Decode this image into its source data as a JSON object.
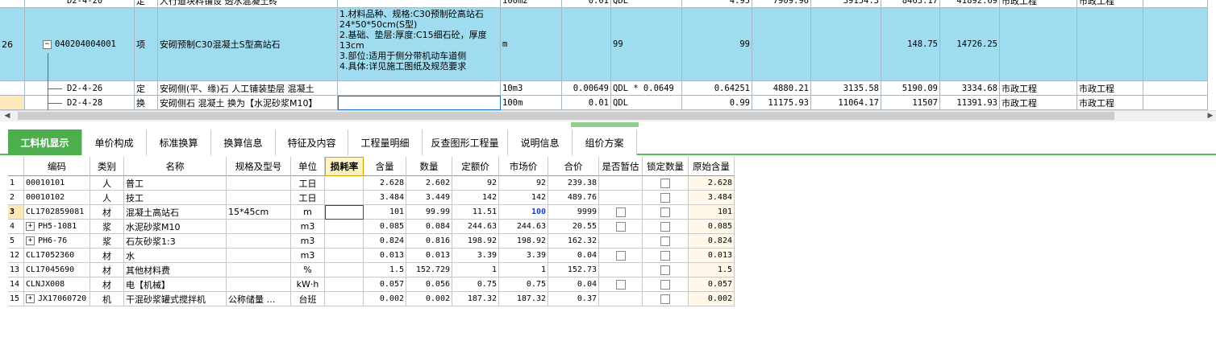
{
  "top_rows": [
    {
      "num": "",
      "code": "D2-4-20",
      "type": "定",
      "name": "人行道块料铺设 透水混凝土砖",
      "feature": "",
      "unit": "100m2",
      "qty": "0.01",
      "formula": "QDL",
      "amount": "4.95",
      "v1": "7909.96",
      "v2": "39154.3",
      "v3": "8463.17",
      "v4": "41892.69",
      "major": "市政工程",
      "major2": "市政工程"
    },
    {
      "num": "26",
      "code": "040204004001",
      "type": "项",
      "name": "安砌预制C30混凝土S型高站石",
      "feature": "1.材料品种、规格:C30预制砼高站石24*50*50cm(S型)\n2.基础、垫层:厚度:C15细石砼，厚度13cm\n3.部位:适用于侧分带机动车道侧\n4.具体:详见施工图纸及规范要求",
      "unit": "m",
      "qty": "",
      "formula": "99",
      "amount": "99",
      "v1": "",
      "v2": "",
      "v3": "148.75",
      "v4": "14726.25",
      "major": "",
      "major2": ""
    },
    {
      "num": "",
      "code": "D2-4-26",
      "type": "定",
      "name": "安砌侧(平、缘)石 人工铺装垫层 混凝土",
      "feature": "",
      "unit": "10m3",
      "qty": "0.00649",
      "formula": "QDL * 0.0649",
      "amount": "0.64251",
      "v1": "4880.21",
      "v2": "3135.58",
      "v3": "5190.09",
      "v4": "3334.68",
      "major": "市政工程",
      "major2": "市政工程"
    },
    {
      "num": "",
      "code": "D2-4-28",
      "type": "换",
      "name": "安砌侧石 混凝土  换为【水泥砂浆M10】",
      "feature": "",
      "unit": "100m",
      "qty": "0.01",
      "formula": "QDL",
      "amount": "0.99",
      "v1": "11175.93",
      "v2": "11064.17",
      "v3": "11507",
      "v4": "11391.93",
      "major": "市政工程",
      "major2": "市政工程"
    }
  ],
  "tabs": [
    "工料机显示",
    "单价构成",
    "标准换算",
    "换算信息",
    "特征及内容",
    "工程量明细",
    "反查图形工程量",
    "说明信息",
    "组价方案"
  ],
  "headers": [
    "编码",
    "类别",
    "名称",
    "规格及型号",
    "单位",
    "损耗率",
    "含量",
    "数量",
    "定额价",
    "市场价",
    "合价",
    "是否暂估",
    "锁定数量",
    "原始含量"
  ],
  "rows": [
    {
      "idx": "1",
      "code": "00010101",
      "cat": "人",
      "name": "普工",
      "spec": "",
      "unit": "工日",
      "loss": "",
      "content": "2.628",
      "qty": "2.602",
      "price": "92",
      "market": "92",
      "total": "239.38",
      "est": false,
      "lock": true,
      "orig": "2.628",
      "expand": false
    },
    {
      "idx": "2",
      "code": "00010102",
      "cat": "人",
      "name": "技工",
      "spec": "",
      "unit": "工日",
      "loss": "",
      "content": "3.484",
      "qty": "3.449",
      "price": "142",
      "market": "142",
      "total": "489.76",
      "est": false,
      "lock": true,
      "orig": "3.484",
      "expand": false
    },
    {
      "idx": "3",
      "code": "CL1702859081",
      "cat": "材",
      "name": "混凝土高站石",
      "spec": "15*45cm",
      "unit": "m",
      "loss": "",
      "content": "101",
      "qty": "99.99",
      "price": "11.51",
      "market": "100",
      "total": "9999",
      "est": true,
      "lock": true,
      "orig": "101",
      "expand": false
    },
    {
      "idx": "4",
      "code": "PH5-1081",
      "cat": "浆",
      "name": "水泥砂浆M10",
      "spec": "",
      "unit": "m3",
      "loss": "",
      "content": "0.085",
      "qty": "0.084",
      "price": "244.63",
      "market": "244.63",
      "total": "20.55",
      "est": true,
      "lock": true,
      "orig": "0.085",
      "expand": true
    },
    {
      "idx": "5",
      "code": "PH6-76",
      "cat": "浆",
      "name": "石灰砂浆1:3",
      "spec": "",
      "unit": "m3",
      "loss": "",
      "content": "0.824",
      "qty": "0.816",
      "price": "198.92",
      "market": "198.92",
      "total": "162.32",
      "est": false,
      "lock": true,
      "orig": "0.824",
      "expand": true
    },
    {
      "idx": "12",
      "code": "CL17052360",
      "cat": "材",
      "name": "水",
      "spec": "",
      "unit": "m3",
      "loss": "",
      "content": "0.013",
      "qty": "0.013",
      "price": "3.39",
      "market": "3.39",
      "total": "0.04",
      "est": true,
      "lock": true,
      "orig": "0.013",
      "expand": false
    },
    {
      "idx": "13",
      "code": "CL17045690",
      "cat": "材",
      "name": "其他材料费",
      "spec": "",
      "unit": "%",
      "loss": "",
      "content": "1.5",
      "qty": "152.729",
      "price": "1",
      "market": "1",
      "total": "152.73",
      "est": false,
      "lock": true,
      "orig": "1.5",
      "expand": false
    },
    {
      "idx": "14",
      "code": "CLNJX008",
      "cat": "材",
      "name": "电【机械】",
      "spec": "",
      "unit": "kW·h",
      "loss": "",
      "content": "0.057",
      "qty": "0.056",
      "price": "0.75",
      "market": "0.75",
      "total": "0.04",
      "est": true,
      "lock": true,
      "orig": "0.057",
      "expand": false
    },
    {
      "idx": "15",
      "code": "JX17060720",
      "cat": "机",
      "name": "干混砂浆罐式搅拌机",
      "spec": "公称储量 …",
      "unit": "台班",
      "loss": "",
      "content": "0.002",
      "qty": "0.002",
      "price": "187.32",
      "market": "187.32",
      "total": "0.37",
      "est": false,
      "lock": true,
      "orig": "0.002",
      "expand": true
    }
  ],
  "colors": {
    "selected_row": "#9fdcf0",
    "tab_active": "#4cae4c",
    "market_price_highlight": "#1a3fd0"
  }
}
